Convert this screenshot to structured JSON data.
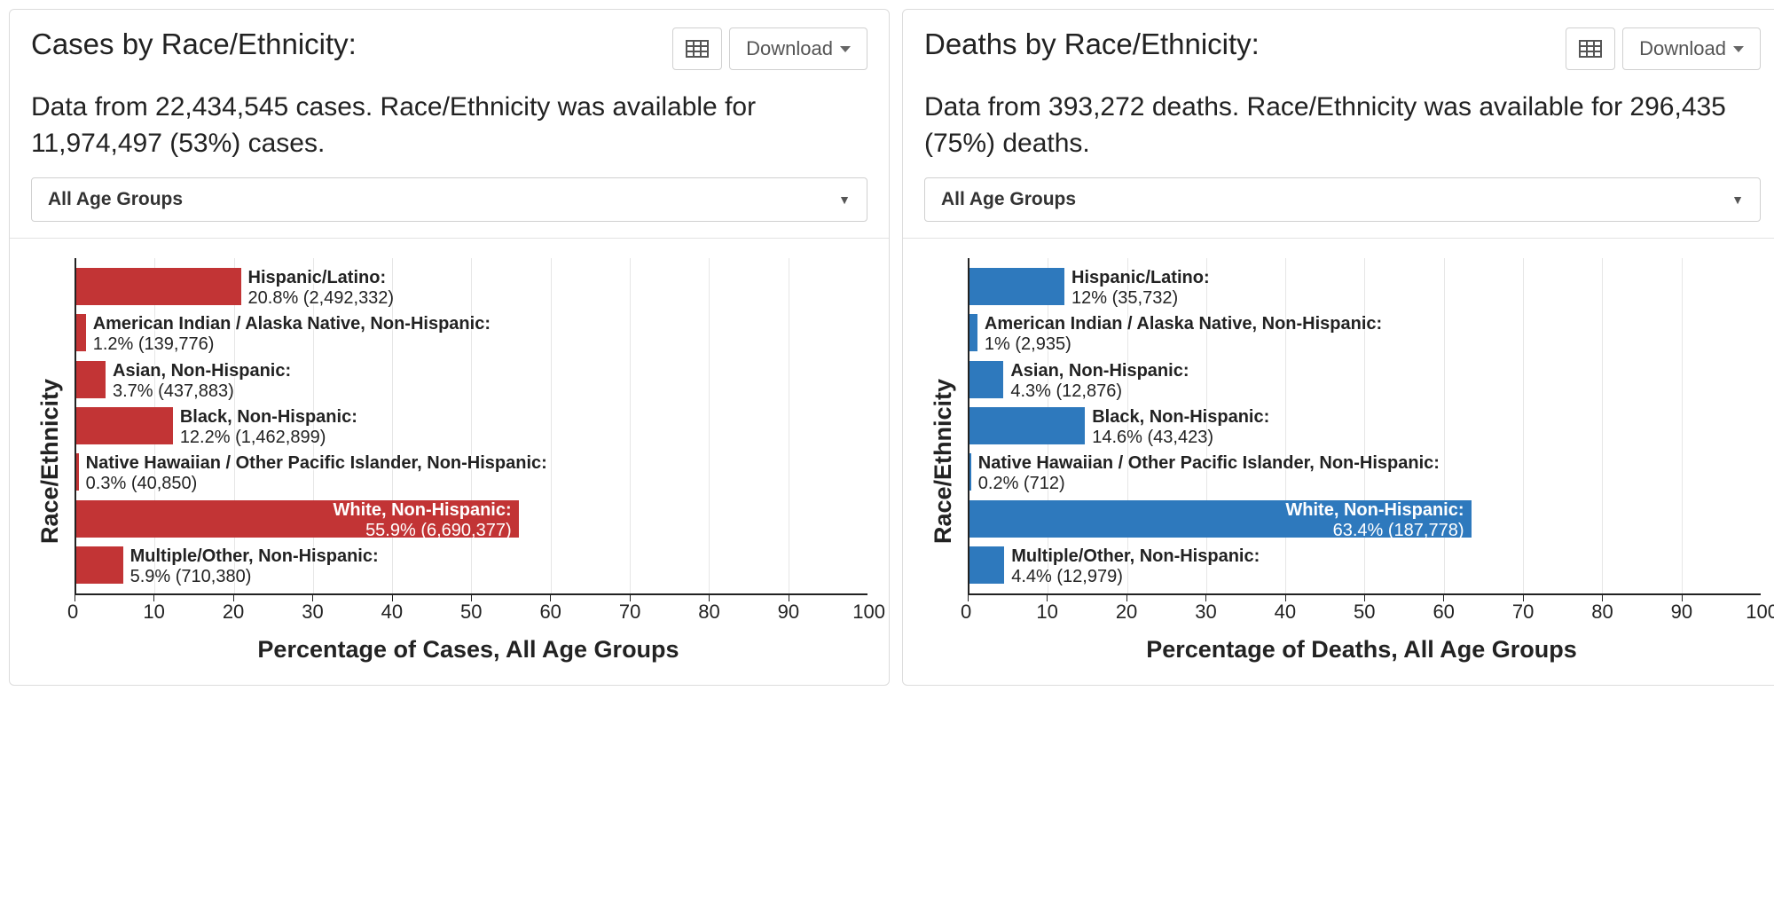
{
  "dropdown_label": "All Age Groups",
  "download_label": "Download",
  "ticks": [
    "0",
    "10",
    "20",
    "30",
    "40",
    "50",
    "60",
    "70",
    "80",
    "90",
    "100"
  ],
  "panels": [
    {
      "title": "Cases by Race/Ethnicity:",
      "subtitle": "Data from 22,434,545 cases. Race/Ethnicity was available for 11,974,497 (53%) cases.",
      "color": "red",
      "ylabel": "Race/Ethnicity",
      "xlabel": "Percentage of Cases, All Age Groups",
      "bars": [
        {
          "label": "Hispanic/Latino:",
          "pct": 20.8,
          "value": "20.8% (2,492,332)",
          "inside": false
        },
        {
          "label": "American Indian / Alaska Native, Non-Hispanic:",
          "pct": 1.2,
          "value": "1.2% (139,776)",
          "inside": false
        },
        {
          "label": "Asian, Non-Hispanic:",
          "pct": 3.7,
          "value": "3.7% (437,883)",
          "inside": false
        },
        {
          "label": "Black, Non-Hispanic:",
          "pct": 12.2,
          "value": "12.2% (1,462,899)",
          "inside": false
        },
        {
          "label": "Native Hawaiian / Other Pacific Islander, Non-Hispanic:",
          "pct": 0.3,
          "value": "0.3% (40,850)",
          "inside": false
        },
        {
          "label": "White, Non-Hispanic:",
          "pct": 55.9,
          "value": "55.9% (6,690,377)",
          "inside": true
        },
        {
          "label": "Multiple/Other, Non-Hispanic:",
          "pct": 5.9,
          "value": "5.9% (710,380)",
          "inside": false
        }
      ]
    },
    {
      "title": "Deaths by Race/Ethnicity:",
      "subtitle": "Data from 393,272 deaths. Race/Ethnicity was available for 296,435 (75%) deaths.",
      "color": "blue",
      "ylabel": "Race/Ethnicity",
      "xlabel": "Percentage of Deaths, All Age Groups",
      "bars": [
        {
          "label": "Hispanic/Latino:",
          "pct": 12.0,
          "value": "12% (35,732)",
          "inside": false
        },
        {
          "label": "American Indian / Alaska Native, Non-Hispanic:",
          "pct": 1.0,
          "value": "1% (2,935)",
          "inside": false
        },
        {
          "label": "Asian, Non-Hispanic:",
          "pct": 4.3,
          "value": "4.3% (12,876)",
          "inside": false
        },
        {
          "label": "Black, Non-Hispanic:",
          "pct": 14.6,
          "value": "14.6% (43,423)",
          "inside": false
        },
        {
          "label": "Native Hawaiian / Other Pacific Islander, Non-Hispanic:",
          "pct": 0.2,
          "value": "0.2% (712)",
          "inside": false
        },
        {
          "label": "White, Non-Hispanic:",
          "pct": 63.4,
          "value": "63.4% (187,778)",
          "inside": true
        },
        {
          "label": "Multiple/Other, Non-Hispanic:",
          "pct": 4.4,
          "value": "4.4% (12,979)",
          "inside": false
        }
      ]
    }
  ],
  "chart_data": [
    {
      "type": "bar",
      "orientation": "horizontal",
      "title": "Cases by Race/Ethnicity:",
      "ylabel": "Race/Ethnicity",
      "xlabel": "Percentage of Cases, All Age Groups",
      "xlim": [
        0,
        100
      ],
      "categories": [
        "Hispanic/Latino",
        "American Indian / Alaska Native, Non-Hispanic",
        "Asian, Non-Hispanic",
        "Black, Non-Hispanic",
        "Native Hawaiian / Other Pacific Islander, Non-Hispanic",
        "White, Non-Hispanic",
        "Multiple/Other, Non-Hispanic"
      ],
      "values": [
        20.8,
        1.2,
        3.7,
        12.2,
        0.3,
        55.9,
        5.9
      ],
      "counts": [
        2492332,
        139776,
        437883,
        1462899,
        40850,
        6690377,
        710380
      ],
      "total_records": 22434545,
      "available_records": 11974497,
      "available_pct": 53,
      "color": "#c23435"
    },
    {
      "type": "bar",
      "orientation": "horizontal",
      "title": "Deaths by Race/Ethnicity:",
      "ylabel": "Race/Ethnicity",
      "xlabel": "Percentage of Deaths, All Age Groups",
      "xlim": [
        0,
        100
      ],
      "categories": [
        "Hispanic/Latino",
        "American Indian / Alaska Native, Non-Hispanic",
        "Asian, Non-Hispanic",
        "Black, Non-Hispanic",
        "Native Hawaiian / Other Pacific Islander, Non-Hispanic",
        "White, Non-Hispanic",
        "Multiple/Other, Non-Hispanic"
      ],
      "values": [
        12.0,
        1.0,
        4.3,
        14.6,
        0.2,
        63.4,
        4.4
      ],
      "counts": [
        35732,
        2935,
        12876,
        43423,
        712,
        187778,
        12979
      ],
      "total_records": 393272,
      "available_records": 296435,
      "available_pct": 75,
      "color": "#2e79bd"
    }
  ]
}
